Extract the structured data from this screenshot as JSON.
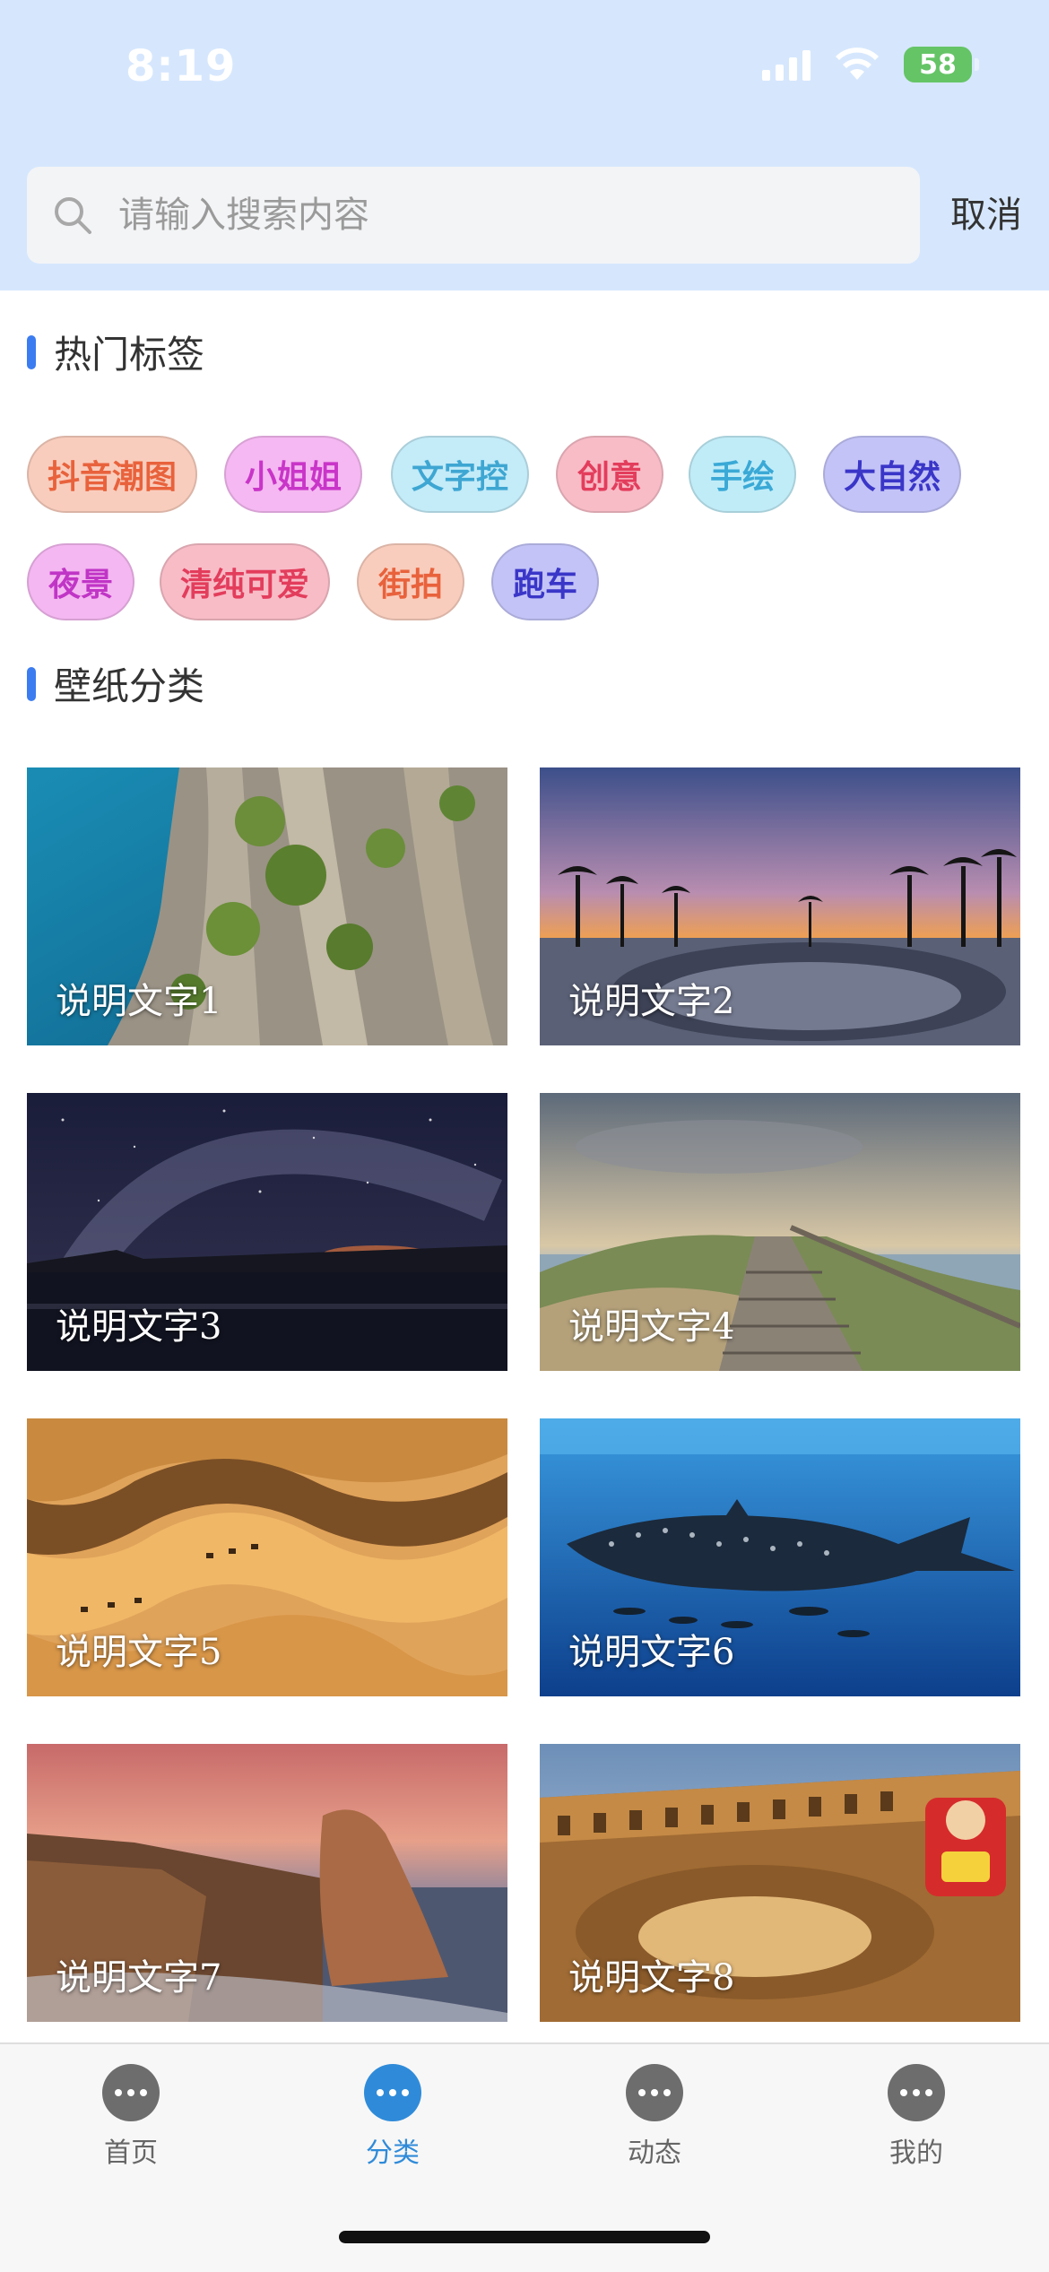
{
  "status_bar": {
    "time": "8:19",
    "battery": "58",
    "icons": [
      "signal-icon",
      "wifi-icon",
      "battery-icon"
    ]
  },
  "search": {
    "placeholder": "请输入搜索内容",
    "value": "",
    "cancel_label": "取消"
  },
  "sections": {
    "hot_tags_title": "热门标签",
    "categories_title": "壁纸分类"
  },
  "tags": [
    {
      "label": "抖音潮图",
      "color": "#e8623c",
      "bg": "#f9cdbd"
    },
    {
      "label": "小姐姐",
      "color": "#c935c8",
      "bg": "#f5b8f2"
    },
    {
      "label": "文字控",
      "color": "#3ea6d2",
      "bg": "#c3ebf8"
    },
    {
      "label": "创意",
      "color": "#e33d5c",
      "bg": "#f8bcc7"
    },
    {
      "label": "手绘",
      "color": "#3aa9d6",
      "bg": "#c0ecf8"
    },
    {
      "label": "大自然",
      "color": "#3a36c8",
      "bg": "#c3c3f7"
    },
    {
      "label": "夜景",
      "color": "#c035c6",
      "bg": "#f4b7f1"
    },
    {
      "label": "清纯可爱",
      "color": "#e33d5c",
      "bg": "#f8bcc7"
    },
    {
      "label": "街拍",
      "color": "#e8623c",
      "bg": "#f9cdbd"
    },
    {
      "label": "跑车",
      "color": "#3a36c8",
      "bg": "#c3c3f7"
    }
  ],
  "wallpapers": [
    {
      "caption": "说明文字1"
    },
    {
      "caption": "说明文字2"
    },
    {
      "caption": "说明文字3"
    },
    {
      "caption": "说明文字4"
    },
    {
      "caption": "说明文字5"
    },
    {
      "caption": "说明文字6"
    },
    {
      "caption": "说明文字7"
    },
    {
      "caption": "说明文字8"
    }
  ],
  "tabbar": {
    "items": [
      {
        "label": "首页",
        "icon": "chat-bubble-icon",
        "active": false
      },
      {
        "label": "分类",
        "icon": "chat-bubble-icon",
        "active": true
      },
      {
        "label": "动态",
        "icon": "chat-bubble-icon",
        "active": false
      },
      {
        "label": "我的",
        "icon": "chat-bubble-icon",
        "active": false
      }
    ],
    "accent_color": "#2f8bd9"
  }
}
